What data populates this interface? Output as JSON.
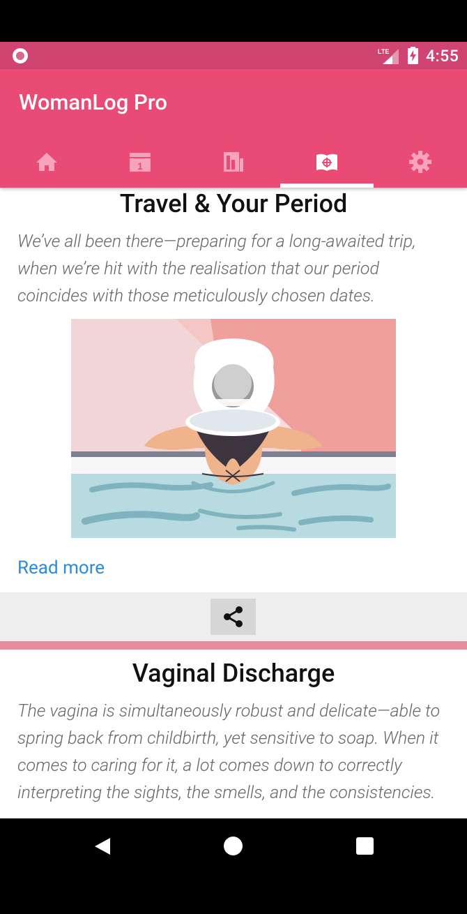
{
  "status_bar": {
    "network": "LTE",
    "time": "4:55"
  },
  "app_bar": {
    "title": "WomanLog Pro",
    "tabs": [
      {
        "icon": "home-icon",
        "active": false
      },
      {
        "icon": "calendar-icon",
        "active": false
      },
      {
        "icon": "stats-icon",
        "active": false
      },
      {
        "icon": "articles-icon",
        "active": true
      },
      {
        "icon": "settings-icon",
        "active": false
      }
    ],
    "tab_colors": {
      "inactive": "#f6a3bb",
      "active": "#ffffff"
    }
  },
  "articles": [
    {
      "title": "Travel & Your Period",
      "excerpt": "We’ve all been there—preparing for a long-awaited trip, when we’re hit with the realisation that our period coincides with those meticulously chosen dates.",
      "read_more": "Read more",
      "share_icon": "share-icon"
    },
    {
      "title": "Vaginal Discharge",
      "excerpt": "The vagina is simultaneously robust and delicate—able to spring back from childbirth, yet sensitive to soap. When it comes to caring for it, a lot comes down to correctly interpreting the sights, the smells, and the consistencies."
    }
  ],
  "colors": {
    "status_bar": "#cf4470",
    "app_bar": "#e94b75",
    "divider": "#e68a9e",
    "link": "#2a8be0"
  },
  "nav_bar": {
    "back_icon": "back-icon",
    "home_icon": "home-circle-icon",
    "recent_icon": "recent-apps-icon"
  }
}
